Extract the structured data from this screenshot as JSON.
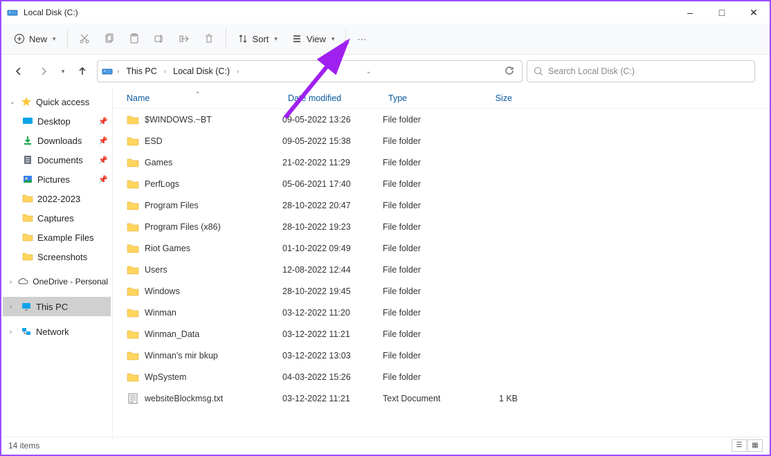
{
  "window": {
    "title": "Local Disk (C:)",
    "minimize": "–",
    "maximize": "□",
    "close": "✕"
  },
  "toolbar": {
    "new_label": "New",
    "sort_label": "Sort",
    "view_label": "View"
  },
  "addr": {
    "crumb1": "This PC",
    "crumb2": "Local Disk (C:)"
  },
  "search": {
    "placeholder": "Search Local Disk (C:)"
  },
  "columns": {
    "name": "Name",
    "modified": "Date modified",
    "type": "Type",
    "size": "Size"
  },
  "sidebar": {
    "quick_access": "Quick access",
    "desktop": "Desktop",
    "downloads": "Downloads",
    "documents": "Documents",
    "pictures": "Pictures",
    "y2022_2023": "2022-2023",
    "captures": "Captures",
    "example_files": "Example Files",
    "screenshots": "Screenshots",
    "onedrive": "OneDrive - Personal",
    "this_pc": "This PC",
    "network": "Network"
  },
  "files": [
    {
      "name": "$WINDOWS.~BT",
      "modified": "09-05-2022 13:26",
      "type": "File folder",
      "size": "",
      "icon": "folder"
    },
    {
      "name": "ESD",
      "modified": "09-05-2022 15:38",
      "type": "File folder",
      "size": "",
      "icon": "folder"
    },
    {
      "name": "Games",
      "modified": "21-02-2022 11:29",
      "type": "File folder",
      "size": "",
      "icon": "folder"
    },
    {
      "name": "PerfLogs",
      "modified": "05-06-2021 17:40",
      "type": "File folder",
      "size": "",
      "icon": "folder"
    },
    {
      "name": "Program Files",
      "modified": "28-10-2022 20:47",
      "type": "File folder",
      "size": "",
      "icon": "folder"
    },
    {
      "name": "Program Files (x86)",
      "modified": "28-10-2022 19:23",
      "type": "File folder",
      "size": "",
      "icon": "folder"
    },
    {
      "name": "Riot Games",
      "modified": "01-10-2022 09:49",
      "type": "File folder",
      "size": "",
      "icon": "folder"
    },
    {
      "name": "Users",
      "modified": "12-08-2022 12:44",
      "type": "File folder",
      "size": "",
      "icon": "folder"
    },
    {
      "name": "Windows",
      "modified": "28-10-2022 19:45",
      "type": "File folder",
      "size": "",
      "icon": "folder"
    },
    {
      "name": "Winman",
      "modified": "03-12-2022 11:20",
      "type": "File folder",
      "size": "",
      "icon": "folder"
    },
    {
      "name": "Winman_Data",
      "modified": "03-12-2022 11:21",
      "type": "File folder",
      "size": "",
      "icon": "folder"
    },
    {
      "name": "Winman's mir bkup",
      "modified": "03-12-2022 13:03",
      "type": "File folder",
      "size": "",
      "icon": "folder"
    },
    {
      "name": "WpSystem",
      "modified": "04-03-2022 15:26",
      "type": "File folder",
      "size": "",
      "icon": "folder"
    },
    {
      "name": "websiteBlockmsg.txt",
      "modified": "03-12-2022 11:21",
      "type": "Text Document",
      "size": "1 KB",
      "icon": "txt"
    }
  ],
  "status": {
    "count": "14 items"
  }
}
